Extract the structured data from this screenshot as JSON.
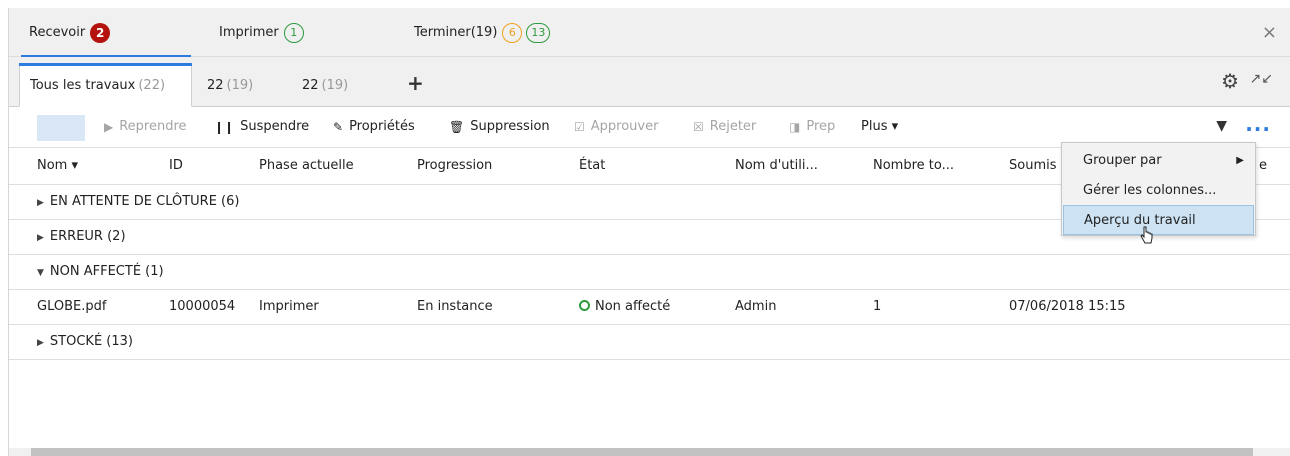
{
  "top_tabs": [
    {
      "label": "Recevoir",
      "badge": "2"
    },
    {
      "label": "Imprimer",
      "badge": "1"
    },
    {
      "label": "Terminer(19)",
      "badge1": "6",
      "badge2": "13"
    }
  ],
  "close_glyph": "×",
  "sub_tabs": [
    {
      "label": "Tous les travaux",
      "count": "(22)"
    },
    {
      "label": "22",
      "count": "(19)"
    },
    {
      "label": "22",
      "count": "(19)"
    }
  ],
  "add_tab": "+",
  "toolbar": {
    "reprendre": "Reprendre",
    "suspendre": "Suspendre",
    "proprietes": "Propriétés",
    "suppression": "Suppression",
    "approuver": "Approuver",
    "rejeter": "Rejeter",
    "prep": "Prep",
    "plus": "Plus ▾",
    "more_glyph": "..."
  },
  "columns": {
    "nom": "Nom ▾",
    "id": "ID",
    "phase": "Phase actuelle",
    "progression": "Progression",
    "etat": "État",
    "user": "Nom d'utili...",
    "nombre": "Nombre to...",
    "soumis": "Soumis",
    "last": "e"
  },
  "groups": [
    {
      "label": "EN ATTENTE DE CLÔTURE (6)",
      "expanded": false
    },
    {
      "label": "ERREUR (2)",
      "expanded": false
    },
    {
      "label": "NON AFFECTÉ (1)",
      "expanded": true
    },
    {
      "label": "STOCKÉ (13)",
      "expanded": false
    }
  ],
  "row": {
    "nom": "GLOBE.pdf",
    "id": "10000054",
    "phase": "Imprimer",
    "progression": "En instance",
    "etat": "Non affecté",
    "user": "Admin",
    "nombre": "1",
    "soumis": "07/06/2018 15:15"
  },
  "menu": {
    "grouper": "Grouper par",
    "gerer": "Gérer les colonnes...",
    "apercu": "Aperçu du travail"
  },
  "colors": {
    "accent": "#2d7be0",
    "badge_red": "#b3120f",
    "badge_green": "#2e9a3e",
    "badge_orange": "#f0a020",
    "menu_highlight": "#cde3f4"
  }
}
